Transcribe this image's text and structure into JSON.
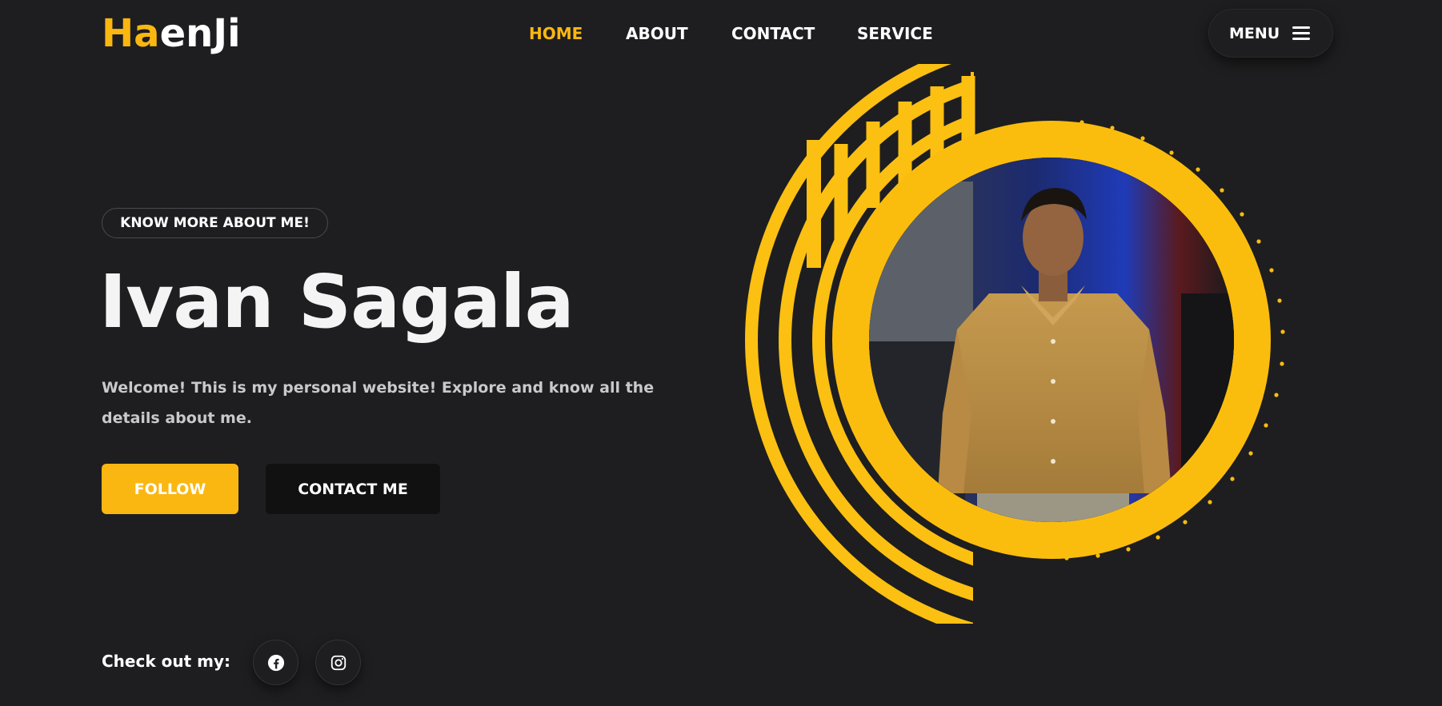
{
  "brand": {
    "logo_accent": "Ha",
    "logo_rest": "enJi",
    "accent_color": "#fbb711",
    "background": "#1e1e20"
  },
  "nav": {
    "items": [
      {
        "label": "HOME",
        "active": true
      },
      {
        "label": "ABOUT",
        "active": false
      },
      {
        "label": "CONTACT",
        "active": false
      },
      {
        "label": "SERVICE",
        "active": false
      }
    ],
    "menu_label": "MENU",
    "menu_icon": "hamburger-icon"
  },
  "hero": {
    "chip": "KNOW MORE ABOUT ME!",
    "name": "Ivan Sagala",
    "intro": "Welcome! This is my personal website! Explore and know all the details about me.",
    "follow_label": "FOLLOW",
    "contact_label": "CONTACT ME",
    "photo_icon": "portrait-photo"
  },
  "social": {
    "label": "Check out my:",
    "links": [
      {
        "icon": "facebook-icon"
      },
      {
        "icon": "instagram-icon"
      }
    ]
  }
}
